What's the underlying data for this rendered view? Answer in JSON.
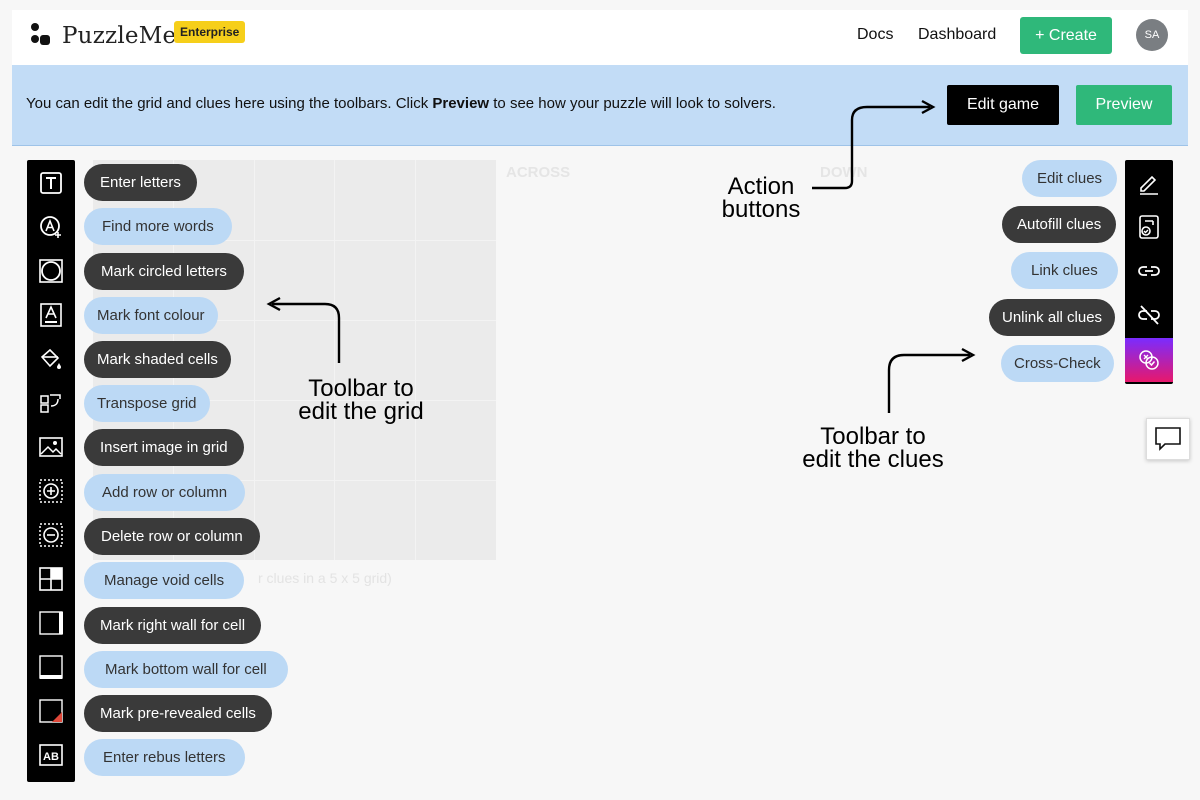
{
  "header": {
    "logo_text": "PuzzleMe",
    "badge": "Enterprise",
    "nav": {
      "docs": "Docs",
      "dashboard": "Dashboard"
    },
    "create_label": "+ Create",
    "avatar_initials": "SA"
  },
  "banner": {
    "text_before": "You can edit the grid and clues here using the toolbars. Click ",
    "text_bold": "Preview",
    "text_after": " to see how your puzzle will look to solvers.",
    "edit_game_label": "Edit game",
    "preview_label": "Preview"
  },
  "background": {
    "across_label": "ACROSS",
    "down_label": "DOWN",
    "grid_caption": "r clues in a 5 x 5 grid)"
  },
  "left_toolbar": {
    "items": [
      {
        "icon": "text-icon",
        "label": "Enter letters",
        "style": "dark"
      },
      {
        "icon": "find-words-icon",
        "label": "Find more words",
        "style": "light"
      },
      {
        "icon": "circle-icon",
        "label": "Mark circled letters",
        "style": "dark"
      },
      {
        "icon": "font-colour-icon",
        "label": "Mark font colour",
        "style": "light"
      },
      {
        "icon": "paint-bucket-icon",
        "label": "Mark shaded cells",
        "style": "dark"
      },
      {
        "icon": "transpose-icon",
        "label": "Transpose grid",
        "style": "light"
      },
      {
        "icon": "image-icon",
        "label": "Insert image in grid",
        "style": "dark"
      },
      {
        "icon": "add-row-icon",
        "label": "Add row or column",
        "style": "light"
      },
      {
        "icon": "delete-row-icon",
        "label": "Delete row or column",
        "style": "dark"
      },
      {
        "icon": "void-cells-icon",
        "label": "Manage void cells",
        "style": "light"
      },
      {
        "icon": "right-wall-icon",
        "label": "Mark right wall for cell",
        "style": "dark"
      },
      {
        "icon": "bottom-wall-icon",
        "label": "Mark bottom wall for cell",
        "style": "light"
      },
      {
        "icon": "pre-revealed-icon",
        "label": "Mark pre-revealed cells",
        "style": "dark"
      },
      {
        "icon": "rebus-icon",
        "label": "Enter rebus letters",
        "style": "light"
      }
    ]
  },
  "right_toolbar": {
    "items": [
      {
        "icon": "pencil-icon",
        "label": "Edit clues",
        "style": "light"
      },
      {
        "icon": "autofill-icon",
        "label": "Autofill clues",
        "style": "dark"
      },
      {
        "icon": "link-icon",
        "label": "Link clues",
        "style": "light"
      },
      {
        "icon": "unlink-icon",
        "label": "Unlink all clues",
        "style": "dark"
      },
      {
        "icon": "cross-check-icon",
        "label": "Cross-Check",
        "style": "light"
      }
    ]
  },
  "annotations": {
    "action_buttons_line1": "Action",
    "action_buttons_line2": "buttons",
    "grid_toolbar_line1": "Toolbar to",
    "grid_toolbar_line2": "edit the grid",
    "clue_toolbar_line1": "Toolbar to",
    "clue_toolbar_line2": "edit the clues"
  },
  "colors": {
    "banner_bg": "#c2dcf6",
    "accent_green": "#2fb87a",
    "badge_yellow": "#f6cf1a",
    "pill_dark": "#3a3a3a",
    "pill_light": "#bcd9f5"
  }
}
